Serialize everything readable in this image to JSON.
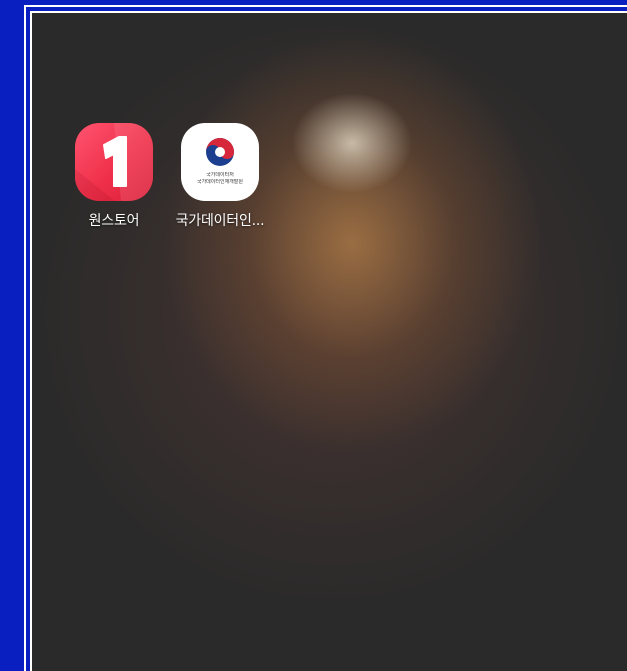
{
  "home_screen": {
    "apps": [
      {
        "label": "원스토어",
        "icon": "onestore-icon",
        "glyph": "1",
        "color": "#f0304a"
      },
      {
        "label": "국가데이터인...",
        "icon": "government-emblem-icon",
        "icon_text_line1": "국가데이터처",
        "icon_text_line2": "국가데이터인재개발원"
      }
    ]
  },
  "colors": {
    "frame_background": "#0a1fbf",
    "wallpaper_base": "#2a2a2a",
    "wallpaper_glow": "#aa7846"
  }
}
